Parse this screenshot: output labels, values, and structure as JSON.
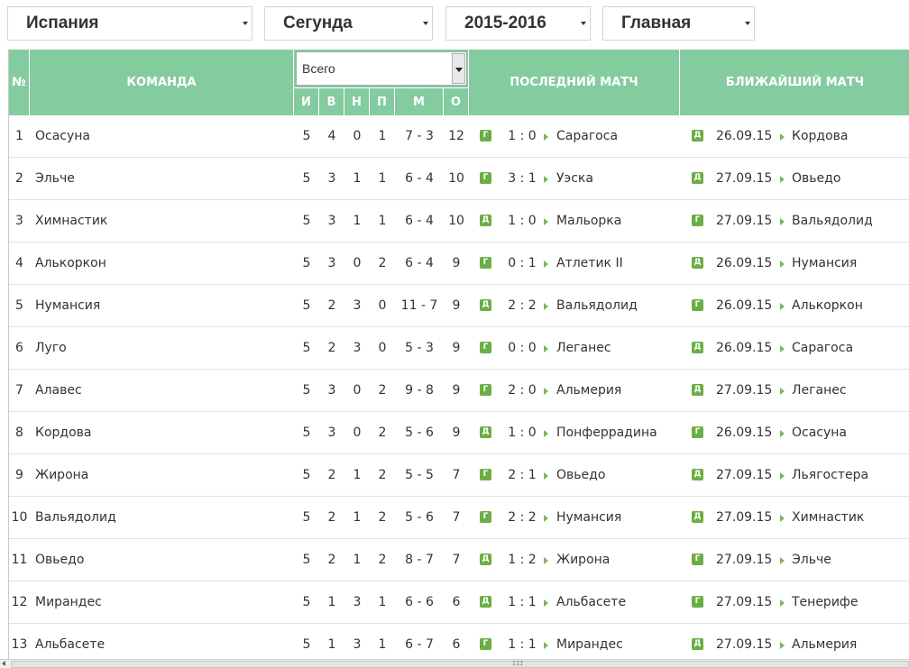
{
  "filters": {
    "country": "Испания",
    "league": "Сегунда",
    "season": "2015-2016",
    "view": "Главная"
  },
  "header": {
    "num": "№",
    "team": "КОМАНДА",
    "scope_select": "Всего",
    "played": "И",
    "won": "В",
    "draw": "Н",
    "lost": "П",
    "goals": "М",
    "points": "О",
    "last_match": "ПОСЛЕДНИЙ МАТЧ",
    "next_match": "БЛИЖАЙШИЙ МАТЧ"
  },
  "rows": [
    {
      "pos": "1",
      "team": "Осасуна",
      "p": "5",
      "w": "4",
      "d": "0",
      "l": "1",
      "g": "7 - 3",
      "pts": "12",
      "last_venue": "Г",
      "last_score": "1 : 0",
      "last_opp": "Сарагоса",
      "next_venue": "Д",
      "next_date": "26.09.15",
      "next_opp": "Кордова"
    },
    {
      "pos": "2",
      "team": "Эльче",
      "p": "5",
      "w": "3",
      "d": "1",
      "l": "1",
      "g": "6 - 4",
      "pts": "10",
      "last_venue": "Г",
      "last_score": "3 : 1",
      "last_opp": "Уэска",
      "next_venue": "Д",
      "next_date": "27.09.15",
      "next_opp": "Овьедо"
    },
    {
      "pos": "3",
      "team": "Химнастик",
      "p": "5",
      "w": "3",
      "d": "1",
      "l": "1",
      "g": "6 - 4",
      "pts": "10",
      "last_venue": "Д",
      "last_score": "1 : 0",
      "last_opp": "Мальорка",
      "next_venue": "Г",
      "next_date": "27.09.15",
      "next_opp": "Вальядолид"
    },
    {
      "pos": "4",
      "team": "Алькоркон",
      "p": "5",
      "w": "3",
      "d": "0",
      "l": "2",
      "g": "6 - 4",
      "pts": "9",
      "last_venue": "Г",
      "last_score": "0 : 1",
      "last_opp": "Атлетик II",
      "next_venue": "Д",
      "next_date": "26.09.15",
      "next_opp": "Нумансия"
    },
    {
      "pos": "5",
      "team": "Нумансия",
      "p": "5",
      "w": "2",
      "d": "3",
      "l": "0",
      "g": "11 - 7",
      "pts": "9",
      "last_venue": "Д",
      "last_score": "2 : 2",
      "last_opp": "Вальядолид",
      "next_venue": "Г",
      "next_date": "26.09.15",
      "next_opp": "Алькоркон"
    },
    {
      "pos": "6",
      "team": "Луго",
      "p": "5",
      "w": "2",
      "d": "3",
      "l": "0",
      "g": "5 - 3",
      "pts": "9",
      "last_venue": "Г",
      "last_score": "0 : 0",
      "last_opp": "Леганес",
      "next_venue": "Д",
      "next_date": "26.09.15",
      "next_opp": "Сарагоса"
    },
    {
      "pos": "7",
      "team": "Алавес",
      "p": "5",
      "w": "3",
      "d": "0",
      "l": "2",
      "g": "9 - 8",
      "pts": "9",
      "last_venue": "Г",
      "last_score": "2 : 0",
      "last_opp": "Альмерия",
      "next_venue": "Д",
      "next_date": "27.09.15",
      "next_opp": "Леганес"
    },
    {
      "pos": "8",
      "team": "Кордова",
      "p": "5",
      "w": "3",
      "d": "0",
      "l": "2",
      "g": "5 - 6",
      "pts": "9",
      "last_venue": "Д",
      "last_score": "1 : 0",
      "last_opp": "Понферрадина",
      "next_venue": "Г",
      "next_date": "26.09.15",
      "next_opp": "Осасуна"
    },
    {
      "pos": "9",
      "team": "Жирона",
      "p": "5",
      "w": "2",
      "d": "1",
      "l": "2",
      "g": "5 - 5",
      "pts": "7",
      "last_venue": "Г",
      "last_score": "2 : 1",
      "last_opp": "Овьедо",
      "next_venue": "Д",
      "next_date": "27.09.15",
      "next_opp": "Льягостера"
    },
    {
      "pos": "10",
      "team": "Вальядолид",
      "p": "5",
      "w": "2",
      "d": "1",
      "l": "2",
      "g": "5 - 6",
      "pts": "7",
      "last_venue": "Г",
      "last_score": "2 : 2",
      "last_opp": "Нумансия",
      "next_venue": "Д",
      "next_date": "27.09.15",
      "next_opp": "Химнастик"
    },
    {
      "pos": "11",
      "team": "Овьедо",
      "p": "5",
      "w": "2",
      "d": "1",
      "l": "2",
      "g": "8 - 7",
      "pts": "7",
      "last_venue": "Д",
      "last_score": "1 : 2",
      "last_opp": "Жирона",
      "next_venue": "Г",
      "next_date": "27.09.15",
      "next_opp": "Эльче"
    },
    {
      "pos": "12",
      "team": "Мирандес",
      "p": "5",
      "w": "1",
      "d": "3",
      "l": "1",
      "g": "6 - 6",
      "pts": "6",
      "last_venue": "Д",
      "last_score": "1 : 1",
      "last_opp": "Альбасете",
      "next_venue": "Г",
      "next_date": "27.09.15",
      "next_opp": "Тенерифе"
    },
    {
      "pos": "13",
      "team": "Альбасете",
      "p": "5",
      "w": "1",
      "d": "3",
      "l": "1",
      "g": "6 - 7",
      "pts": "6",
      "last_venue": "Г",
      "last_score": "1 : 1",
      "last_opp": "Мирандес",
      "next_venue": "Д",
      "next_date": "27.09.15",
      "next_opp": "Альмерия"
    }
  ],
  "scrollbar": {
    "grip": "III"
  },
  "colors": {
    "header_bg": "#84cca0",
    "badge_green": "#6cae45",
    "arrow_green": "#7cb55e"
  }
}
